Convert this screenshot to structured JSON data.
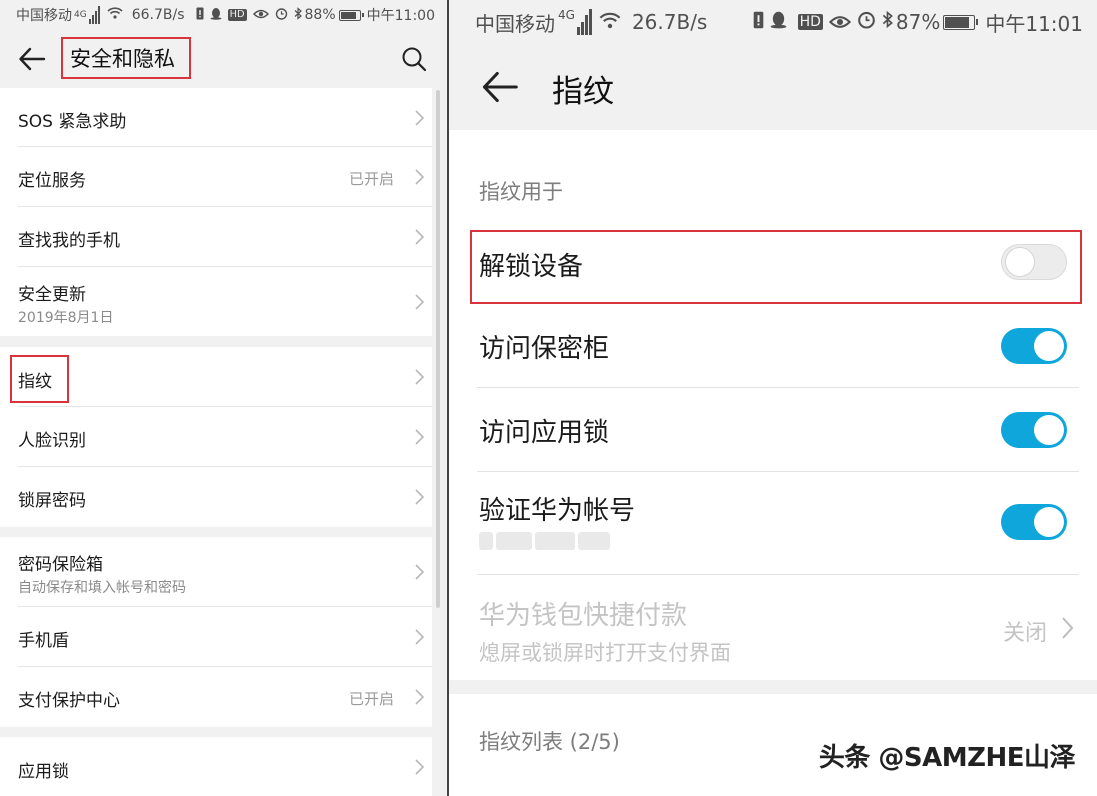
{
  "left": {
    "status": {
      "carrier": "中国移动",
      "network": "4G",
      "speed": "66.7B/s",
      "battery": "88%",
      "battery_level": 0.88,
      "time": "中午11:00"
    },
    "header": {
      "title": "安全和隐私"
    },
    "items": [
      {
        "label": "SOS 紧急求助"
      },
      {
        "label": "定位服务",
        "value": "已开启"
      },
      {
        "label": "查找我的手机"
      },
      {
        "label": "安全更新",
        "sub": "2019年8月1日"
      },
      {
        "label": "指纹"
      },
      {
        "label": "人脸识别"
      },
      {
        "label": "锁屏密码"
      },
      {
        "label": "密码保险箱",
        "sub": "自动保存和填入帐号和密码"
      },
      {
        "label": "手机盾"
      },
      {
        "label": "支付保护中心",
        "value": "已开启"
      },
      {
        "label": "应用锁"
      }
    ]
  },
  "right": {
    "status": {
      "carrier": "中国移动",
      "network": "4G",
      "speed": "26.7B/s",
      "battery": "87%",
      "battery_level": 0.87,
      "time": "中午11:01"
    },
    "header": {
      "title": "指纹"
    },
    "section_usage": "指纹用于",
    "items": [
      {
        "label": "解锁设备",
        "on": false
      },
      {
        "label": "访问保密柜",
        "on": true
      },
      {
        "label": "访问应用锁",
        "on": true
      },
      {
        "label": "验证华为帐号",
        "on": true
      },
      {
        "label": "华为钱包快捷付款",
        "sub": "熄屏或锁屏时打开支付界面",
        "value": "关闭",
        "disabled": true
      }
    ],
    "section_list": "指纹列表 (2/5)"
  },
  "watermark": "头条 @SAMZHE山泽",
  "colors": {
    "accent": "#0fa6dc",
    "highlight": "#d9333c"
  }
}
